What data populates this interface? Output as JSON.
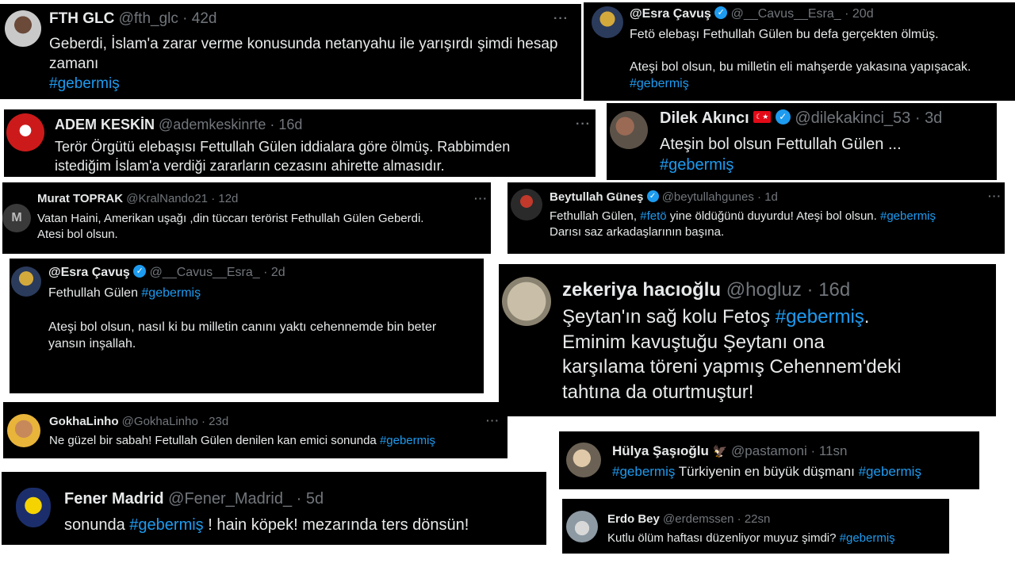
{
  "tweets": [
    {
      "name": "FTH GLC",
      "handle": "@fth_glc",
      "sep": "·",
      "date": "42d",
      "more": "···",
      "line1": "Geberdi, İslam'a zarar verme konusunda netanyahu ile yarışırdı şimdi hesap",
      "line2": "zamanı",
      "hashtag": "#gebermiş"
    },
    {
      "name": "@Esra Çavuş",
      "handle": "@__Cavus__Esra_",
      "sep": "·",
      "date": "20d",
      "line1": "Fetö elebaşı Fethullah Gülen bu defa gerçekten ölmüş.",
      "line2": "Ateşi bol olsun, bu milletin eli mahşerde yakasına yapışacak.",
      "hashtag": "#gebermiş"
    },
    {
      "name": "ADEM KESKİN",
      "handle": "@ademkeskinrte",
      "sep": "·",
      "date": "16d",
      "more": "···",
      "line1": "Terör Örgütü elebaşısı Fettullah Gülen iddialara göre ölmüş. Rabbimden",
      "line2": "istediğim İslam'a verdiği zararların cezasını ahirette almasıdır."
    },
    {
      "name": "Dilek Akıncı",
      "handle": "@dilekakinci_53",
      "sep": "·",
      "date": "3d",
      "line1": "Ateşin bol olsun Fettullah Gülen ...",
      "hashtag": "#gebermiş"
    },
    {
      "name": "Murat TOPRAK",
      "handle": "@KralNando21",
      "sep": "·",
      "date": "12d",
      "more": "···",
      "line1": "Vatan Haini, Amerikan uşağı ,din tüccarı terörist Fethullah Gülen Geberdi.",
      "line2": "Atesi bol olsun."
    },
    {
      "name": "Beytullah Güneş",
      "handle": "@beytullahgunes",
      "sep": "·",
      "date": "1d",
      "more": "···",
      "line1_a": "Fethullah Gülen, ",
      "line1_hash": "#fetö",
      "line1_b": " yine öldüğünü duyurdu! Ateşi bol olsun. ",
      "hashtag": "#gebermiş",
      "line2": "Darısı saz arkadaşlarının başına."
    },
    {
      "name": "@Esra Çavuş",
      "handle": "@__Cavus__Esra_",
      "sep": "·",
      "date": "2d",
      "line1_a": "Fethullah Gülen ",
      "hashtag": "#gebermiş",
      "line2": "Ateşi bol olsun, nasıl ki bu milletin canını yaktı cehennemde bin beter",
      "line3": "yansın inşallah."
    },
    {
      "name": "zekeriya hacıoğlu",
      "handle": "@hogluz",
      "sep": "·",
      "date": "16d",
      "line1_a": "Şeytan'ın sağ kolu Fetoş ",
      "hashtag": "#gebermiş",
      "line1_b": ".",
      "line2": "Eminim kavuştuğu Şeytanı ona",
      "line3": "karşılama töreni yapmış Cehennem'deki",
      "line4": "tahtına da oturtmuştur!"
    },
    {
      "name": "GokhaLinho",
      "handle": "@GokhaLinho",
      "sep": "·",
      "date": "23d",
      "more": "···",
      "line1_a": "Ne güzel bir sabah! Fetullah Gülen denilen kan emici sonunda ",
      "hashtag": "#gebermiş"
    },
    {
      "name": "Hülya Şaşıoğlu",
      "handle": "@pastamoni",
      "sep": "·",
      "date": "11sn",
      "hashtag": "#gebermiş",
      "line1_b": " Türkiyenin en büyük düşmanı ",
      "hashtag2": "#gebermiş"
    },
    {
      "name": "Fener Madrid",
      "handle": "@Fener_Madrid_",
      "sep": "·",
      "date": "5d",
      "line1_a": "sonunda ",
      "hashtag": "#gebermiş",
      "line1_b": " ! hain köpek! mezarında ters dönsün!"
    },
    {
      "name": "Erdo Bey",
      "handle": "@erdemssen",
      "sep": "·",
      "date": "22sn",
      "line1_a": "Kutlu ölüm haftası düzenliyor muyuz şimdi? ",
      "hashtag": "#gebermiş"
    }
  ],
  "verified_glyph": "✓",
  "eagle_emoji": "🦅",
  "colors": {
    "background": "#000000",
    "text": "#e7e9ea",
    "muted": "#71767b",
    "hashtag": "#1d9bf0",
    "verified": "#1d9bf0"
  }
}
